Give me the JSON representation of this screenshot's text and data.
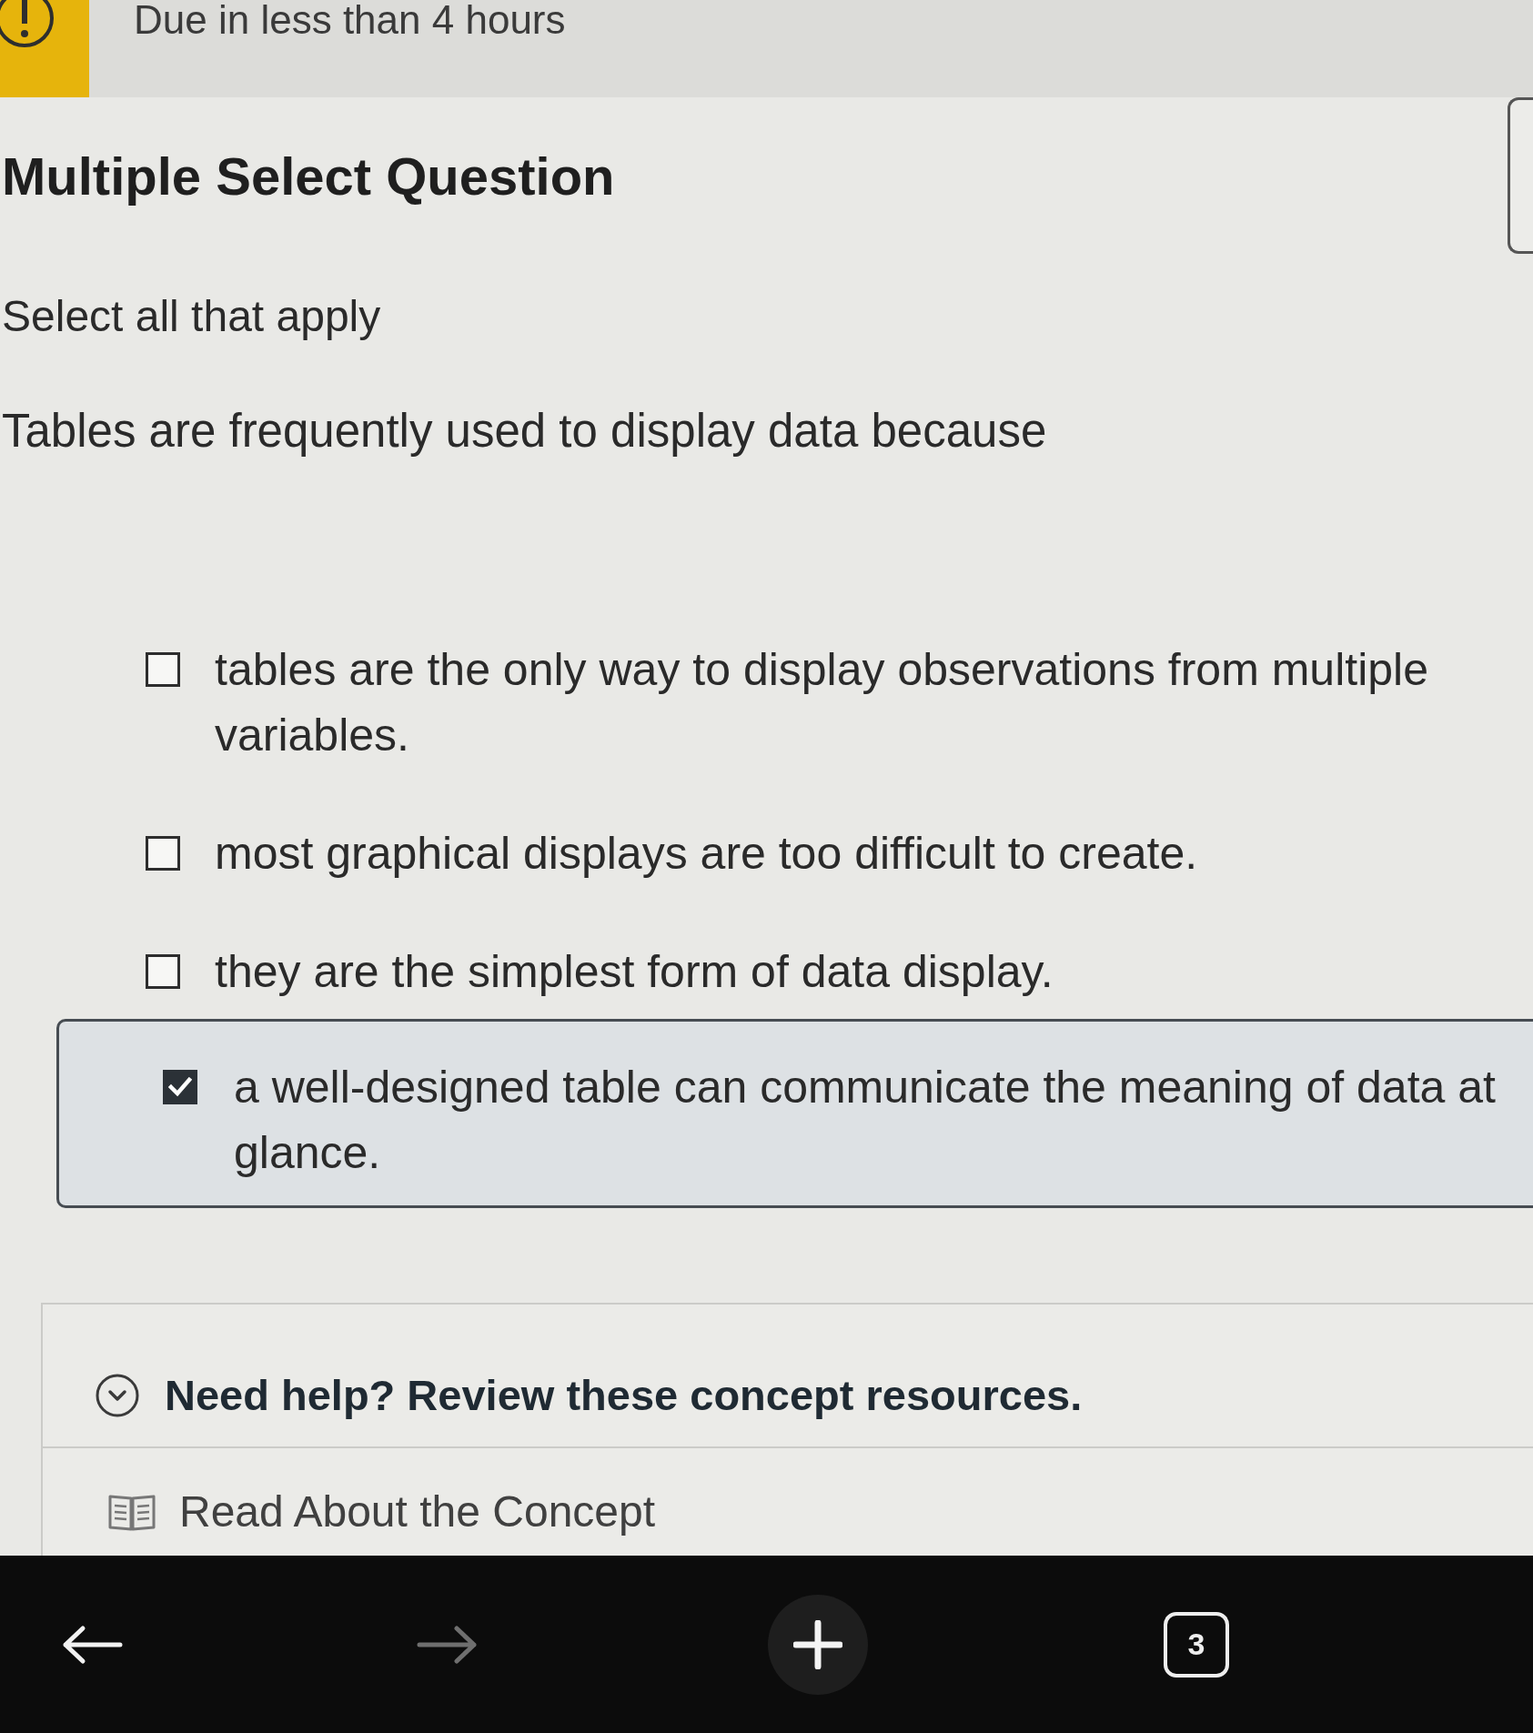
{
  "banner": {
    "due_text": "Due in less than 4 hours"
  },
  "question": {
    "type": "Multiple Select Question",
    "instruction": "Select all that apply",
    "prompt": "Tables are frequently used to display data because"
  },
  "options": [
    {
      "label": "tables are the only way to display observations from multiple variables.",
      "checked": false
    },
    {
      "label": "most graphical displays are too difficult to create.",
      "checked": false
    },
    {
      "label": "they are the simplest form of data display.",
      "checked": false
    },
    {
      "label": "a well-designed table can communicate the meaning of data at glance.",
      "checked": true
    }
  ],
  "help": {
    "title": "Need help? Review these concept resources.",
    "resources": [
      {
        "label": "Read About the Concept"
      }
    ]
  },
  "browser_toolbar": {
    "buttons": [
      {
        "kind": "back",
        "disabled": false
      },
      {
        "kind": "forward",
        "disabled": true
      },
      {
        "kind": "new_tab",
        "disabled": false
      }
    ],
    "tab_count": "3"
  }
}
